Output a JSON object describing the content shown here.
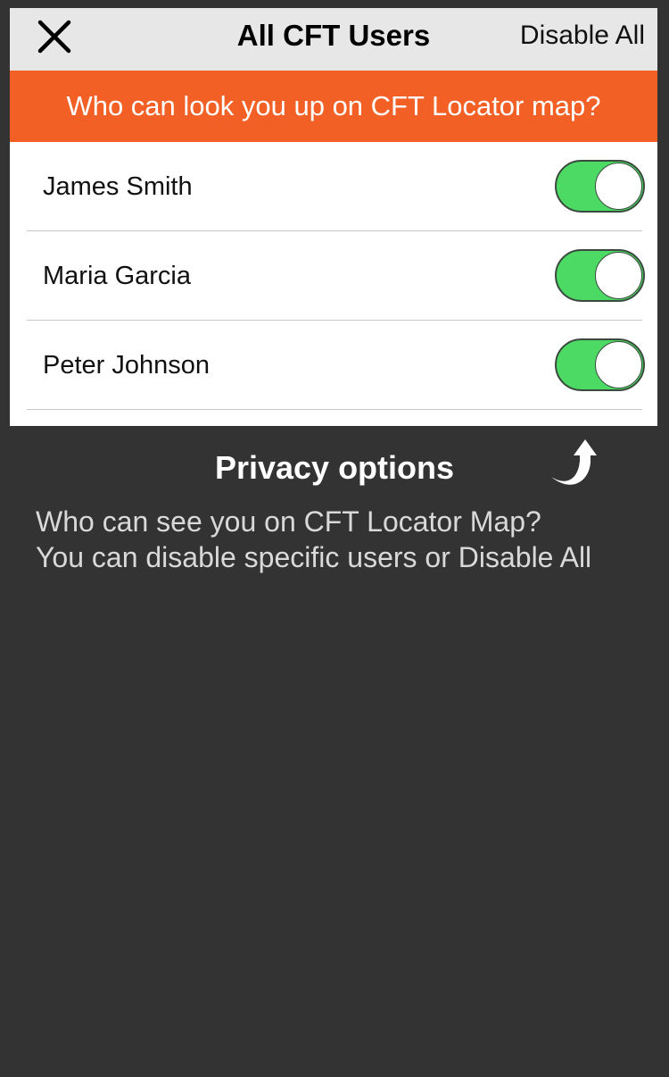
{
  "nav": {
    "title": "All CFT Users",
    "action_label": "Disable All",
    "close_icon": "close-icon"
  },
  "banner": {
    "text": "Who can look you up on CFT Locator map?"
  },
  "users": [
    {
      "name": "James Smith",
      "enabled": true
    },
    {
      "name": "Maria Garcia",
      "enabled": true
    },
    {
      "name": "Peter Johnson",
      "enabled": true
    }
  ],
  "overlay": {
    "title": "Privacy options",
    "lines": [
      "Who can see you on CFT Locator Map?",
      "You can disable specific users or Disable All"
    ],
    "arrow_icon": "curved-arrow-up-icon"
  },
  "colors": {
    "accent": "#f26025",
    "toggle_on": "#4cd964",
    "nav_bg": "#e6e7e6",
    "overlay_bg": "#333333"
  }
}
